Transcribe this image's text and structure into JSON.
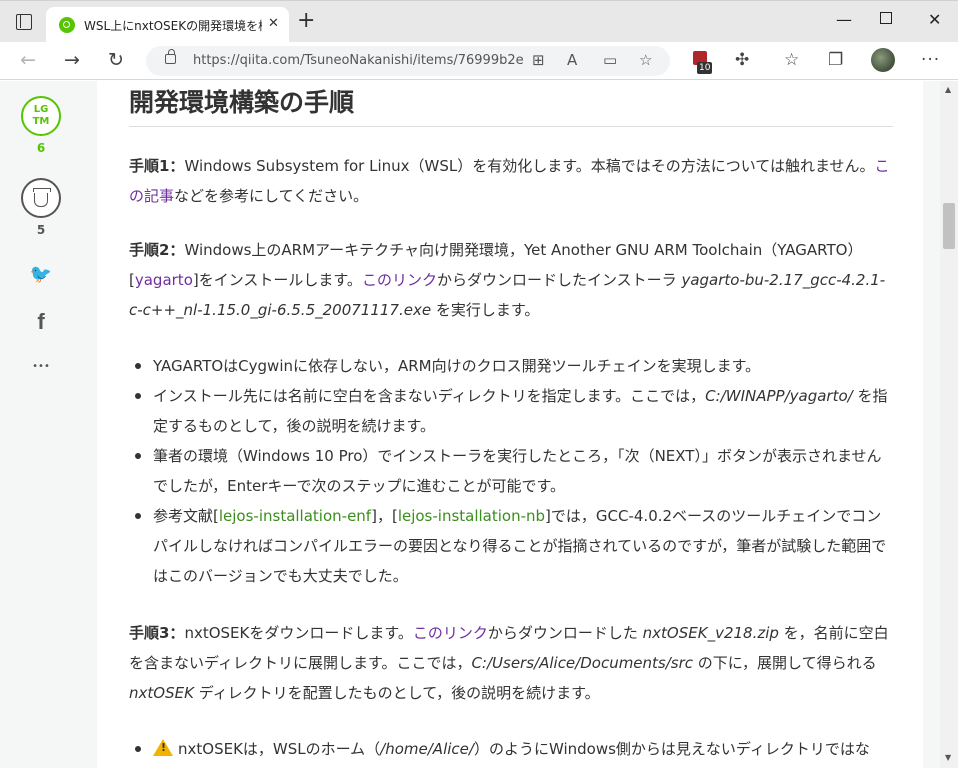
{
  "browser": {
    "tab_title": "WSL上にnxtOSEKの開発環境を構築",
    "url": "https://qiita.com/TsuneoNakanishi/items/76999b2e...",
    "extension_badge": "10",
    "icons": [
      "tab-actions-icon",
      "close-icon",
      "plus-icon",
      "minimize-icon",
      "maximize-icon",
      "back-icon",
      "forward-icon",
      "refresh-icon",
      "lock-icon",
      "grid-icon",
      "read-aloud-icon",
      "reader-icon",
      "favorite-add-icon",
      "extension-icon",
      "puzzle-icon",
      "favorites-icon",
      "collections-icon",
      "profile-avatar",
      "more-icon"
    ]
  },
  "sidebar": {
    "lgtm_line1": "LG",
    "lgtm_line2": "TM",
    "lgtm_count": "6",
    "stock_count": "5",
    "twitter": "🐦",
    "facebook": "f",
    "more": "•••"
  },
  "article": {
    "heading": "開発環境構築の手順",
    "step1": {
      "label": "手順1：",
      "text1": "Windows Subsystem for Linux（WSL）を有効化します。本稿ではその方法については触れません。",
      "link": "この記事",
      "text2": "などを参考にしてください。"
    },
    "step2": {
      "label": "手順2：",
      "text1": "Windows上のARMアーキテクチャ向け開発環境，Yet Another GNU ARM Toolchain（YAGARTO）[",
      "ref": "yagarto",
      "text2": "]をインストールします。",
      "link": "このリンク",
      "text3": "からダウンロードしたインストーラ ",
      "file": "yagarto-bu-2.17_gcc-4.2.1-c-c++_nl-1.15.0_gi-6.5.5_20071117.exe",
      "text4": " を実行します。"
    },
    "bullets": {
      "b1": "YAGARTOはCygwinに依存しない，ARM向けのクロス開発ツールチェインを実現します。",
      "b2_text1": "インストール先には名前に空白を含まないディレクトリを指定します。ここでは，",
      "b2_path": "C:/WINAPP/yagarto/",
      "b2_text2": " を指定するものとして，後の説明を続けます。",
      "b3": "筆者の環境（Windows 10 Pro）でインストーラを実行したところ，「次（NEXT）」ボタンが表示されませんでしたが，Enterキーで次のステップに進むことが可能です。",
      "b4_text1": "参考文献[",
      "b4_ref1": "lejos-installation-enf",
      "b4_text2": "]，[",
      "b4_ref2": "lejos-installation-nb",
      "b4_text3": "]では，GCC-4.0.2ベースのツールチェインでコンパイルしなければコンパイルエラーの要因となり得ることが指摘されているのですが，筆者が試験した範囲ではこのバージョンでも大丈夫でした。"
    },
    "step3": {
      "label": "手順3：",
      "text1": "nxtOSEKをダウンロードします。",
      "link": "このリンク",
      "text2": "からダウンロードした ",
      "file": "nxtOSEK_v218.zip",
      "text3": " を，名前に空白を含まないディレクトリに展開します。ここでは，",
      "path": "C:/Users/Alice/Documents/src",
      "text4": " の下に，展開して得られる ",
      "dir": "nxtOSEK",
      "text5": " ディレクトリを配置したものとして，後の説明を続けます。"
    },
    "bullet_last": {
      "text1": "nxtOSEKは，WSLのホーム（",
      "path": "/home/Alice/",
      "text2": "）のようにWindows側からは見えないディレクトリではな"
    }
  }
}
